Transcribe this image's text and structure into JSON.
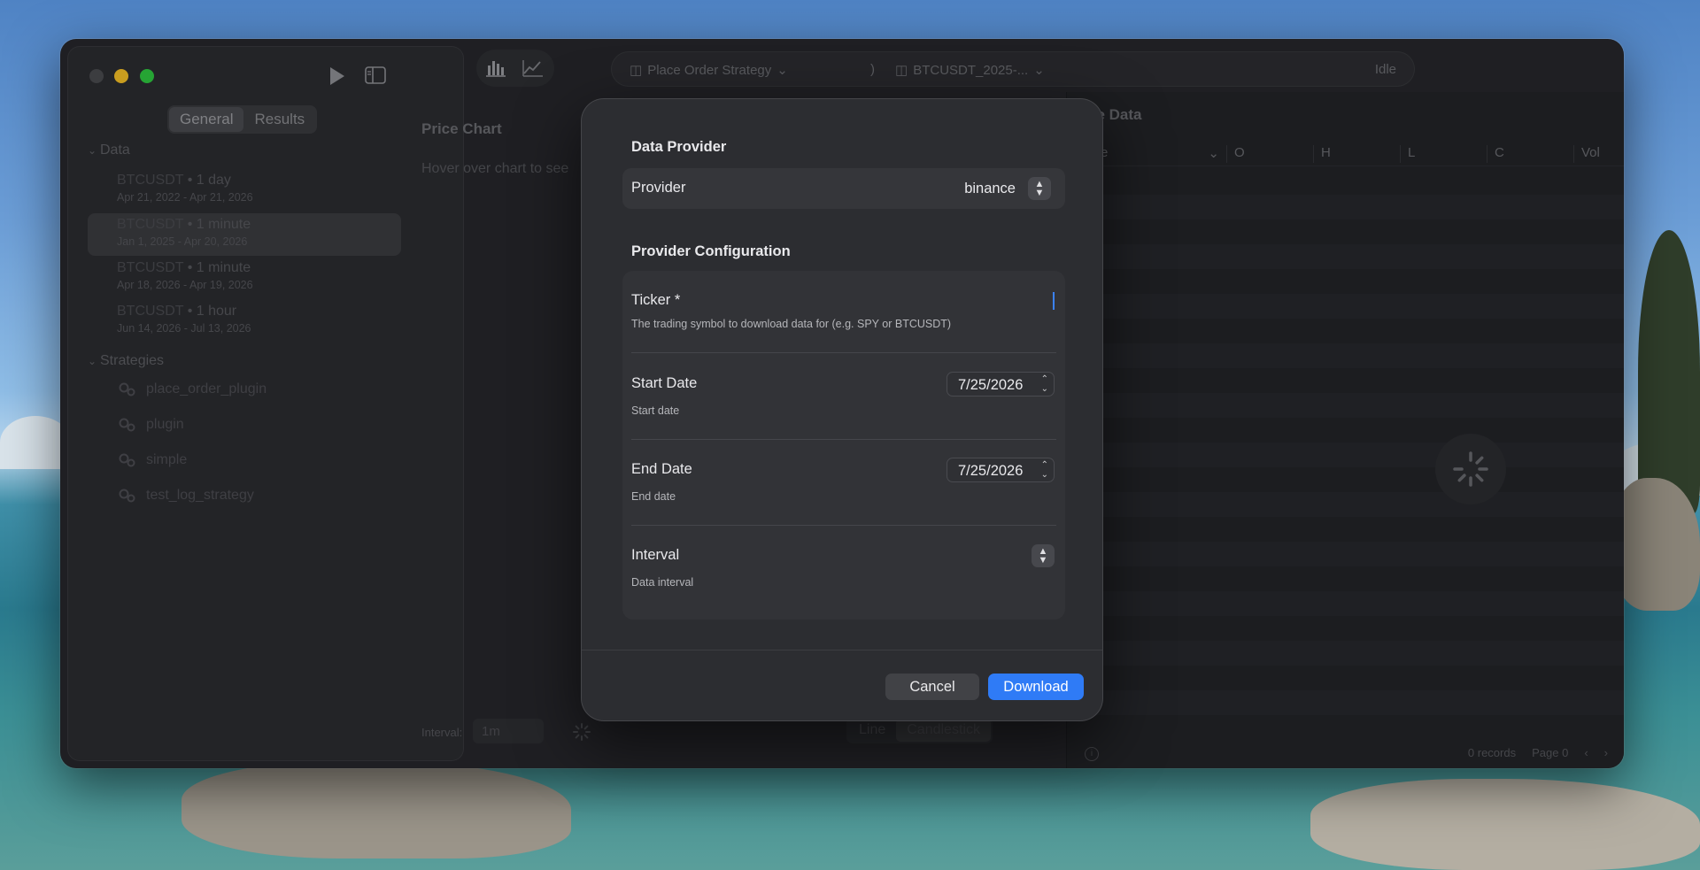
{
  "sidebar": {
    "tabs": [
      {
        "label": "General",
        "active": true
      },
      {
        "label": "Results",
        "active": false
      }
    ],
    "data_section": "Data",
    "data_items": [
      {
        "symbol": "BTCUSDT",
        "interval": "1 day",
        "range": "Apr 21, 2022 - Apr 21, 2026",
        "selected": false
      },
      {
        "symbol": "BTCUSDT",
        "interval": "1 minute",
        "range": "Jan 1, 2025 - Apr 20, 2026",
        "selected": true
      },
      {
        "symbol": "BTCUSDT",
        "interval": "1 minute",
        "range": "Apr 18, 2026 - Apr 19, 2026",
        "selected": false
      },
      {
        "symbol": "BTCUSDT",
        "interval": "1 hour",
        "range": "Jun 14, 2026 - Jul 13, 2026",
        "selected": false
      }
    ],
    "strategies_section": "Strategies",
    "strategies": [
      "place_order_plugin",
      "plugin",
      "simple",
      "test_log_strategy"
    ]
  },
  "toolbar": {
    "strategy_crumb": "Place Order Strategy",
    "separator": ")",
    "dataset_crumb": "BTCUSDT_2025-...",
    "status": "Idle"
  },
  "chart": {
    "title": "Price Chart",
    "hover_hint": "Hover over chart to see",
    "interval_label": "Interval:",
    "interval_value": "1m",
    "modes": [
      "Line",
      "Candlestick"
    ],
    "active_mode": "Candlestick"
  },
  "price_data": {
    "title": "ce Data",
    "columns": [
      "e",
      "O",
      "H",
      "L",
      "C",
      "Vol"
    ],
    "records": "0 records",
    "page": "Page 0"
  },
  "modal": {
    "data_provider_heading": "Data Provider",
    "provider_label": "Provider",
    "provider_value": "binance",
    "config_heading": "Provider Configuration",
    "ticker_label": "Ticker *",
    "ticker_desc": "The trading symbol to download data for (e.g. SPY or BTCUSDT)",
    "start_label": "Start Date",
    "start_value": "7/25/2026",
    "start_desc": "Start date",
    "end_label": "End Date",
    "end_value": "7/25/2026",
    "end_desc": "End date",
    "interval_label": "Interval",
    "interval_desc": "Data interval",
    "cancel": "Cancel",
    "download": "Download"
  },
  "colors": {
    "accent": "#2f7bf6",
    "window_bg": "#26272b",
    "modal_bg": "#2c2d31"
  }
}
